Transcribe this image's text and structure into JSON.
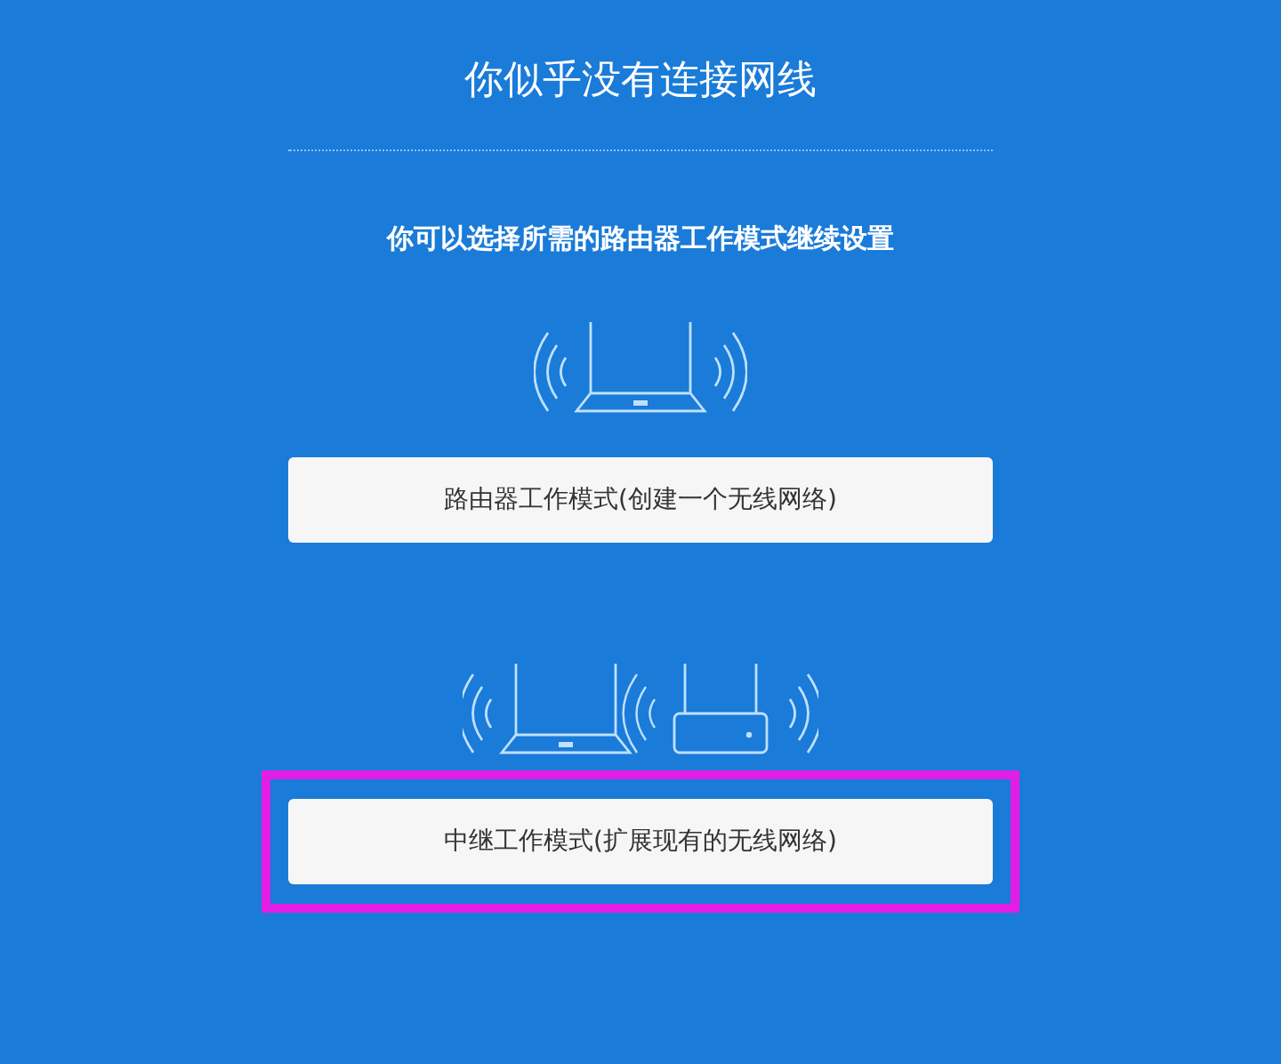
{
  "title": "你似乎没有连接网线",
  "subtitle": "你可以选择所需的路由器工作模式继续设置",
  "modes": [
    {
      "kind": "single",
      "label": "路由器工作模式(创建一个无线网络)",
      "highlighted": false
    },
    {
      "kind": "repeater",
      "label": "中继工作模式(扩展现有的无线网络)",
      "highlighted": true
    }
  ]
}
